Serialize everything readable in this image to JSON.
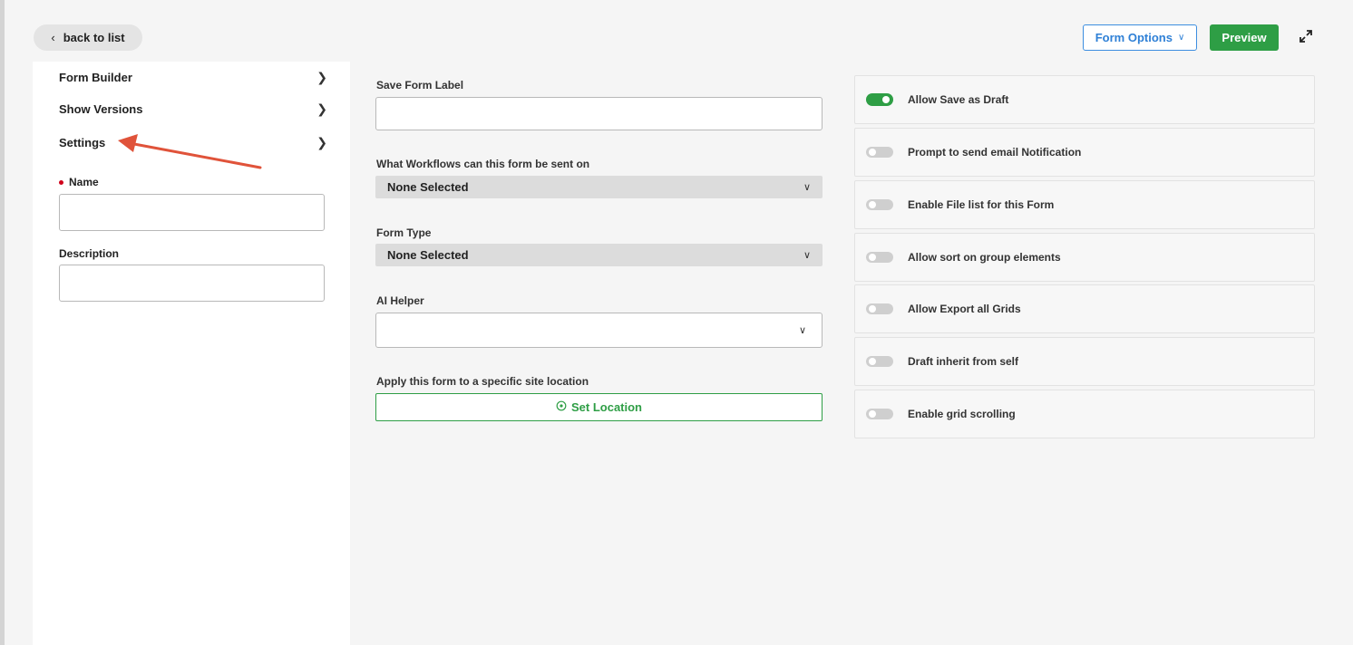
{
  "topbar": {
    "back_label": "back to list",
    "form_options_label": "Form Options",
    "preview_label": "Preview"
  },
  "sidebar": {
    "items": [
      {
        "label": "Form Builder"
      },
      {
        "label": "Show Versions"
      },
      {
        "label": "Settings"
      }
    ],
    "name_label": "Name",
    "name_value": "",
    "description_label": "Description",
    "description_value": ""
  },
  "settings": {
    "save_form_label": "Save Form Label",
    "save_form_value": "",
    "workflows_label": "What Workflows can this form be sent on",
    "workflows_value": "None Selected",
    "form_type_label": "Form Type",
    "form_type_value": "None Selected",
    "ai_helper_label": "AI Helper",
    "ai_helper_value": "",
    "location_label": "Apply this form to a specific site location",
    "set_location_label": "Set Location"
  },
  "toggles": [
    {
      "label": "Allow Save as Draft",
      "on": true
    },
    {
      "label": "Prompt to send email Notification",
      "on": false
    },
    {
      "label": "Enable File list for this Form",
      "on": false
    },
    {
      "label": "Allow sort on group elements",
      "on": false
    },
    {
      "label": "Allow Export all Grids",
      "on": false
    },
    {
      "label": "Draft inherit from self",
      "on": false
    },
    {
      "label": "Enable grid scrolling",
      "on": false
    }
  ],
  "colors": {
    "accent_green": "#2e9e45",
    "accent_blue": "#2f80d6",
    "required_red": "#d0021b",
    "annotation_arrow": "#e0533a"
  },
  "icons": {
    "back": "chevron-left-icon",
    "nav": "chevron-right-icon",
    "dropdown": "chevron-down-icon",
    "expand": "expand-icon",
    "location": "target-icon"
  }
}
